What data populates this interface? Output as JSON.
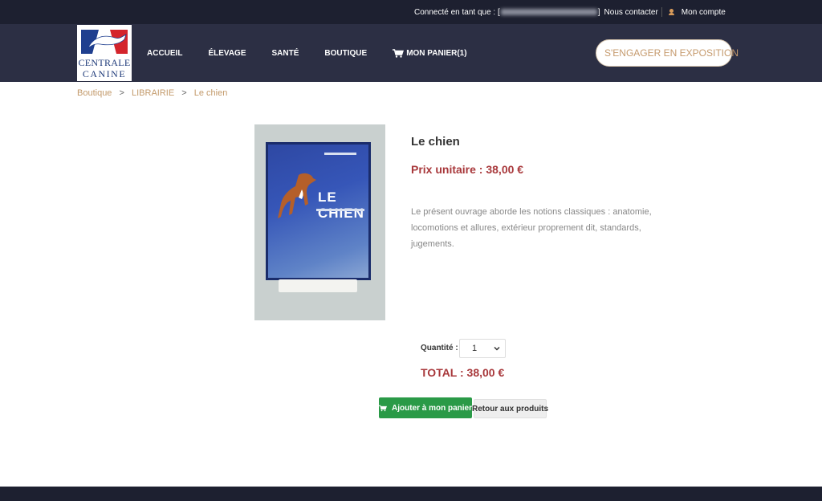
{
  "topbar": {
    "connected_prefix": "Connecté en tant que : [",
    "connected_suffix": "]",
    "contact_label": "Nous contacter",
    "account_label": "Mon compte"
  },
  "logo": {
    "line1": "CENTRALE",
    "line2": "CANINE"
  },
  "nav": {
    "items": [
      "ACCUEIL",
      "ÉLEVAGE",
      "SANTÉ",
      "BOUTIQUE"
    ],
    "cart_label": "MON PANIER(1)",
    "cta_label": "S'ENGAGER EN EXPOSITION"
  },
  "breadcrumb": {
    "items": [
      "Boutique",
      "LIBRAIRIE",
      "Le chien"
    ],
    "separator": ">"
  },
  "product": {
    "cover_title": "LE CHIEN",
    "title": "Le chien",
    "unit_price": "Prix unitaire : 38,00 €",
    "description": "Le présent ouvrage aborde les notions classiques : anatomie, locomotions et allures, extérieur proprement dit, standards, jugements."
  },
  "order": {
    "quantity_label": "Quantité :",
    "quantity_value": "1",
    "total": "TOTAL : 38,00 €",
    "add_to_cart_label": "Ajouter à mon panier",
    "back_label": "Retour aux produits"
  },
  "colors": {
    "topbar_bg": "#1d2030",
    "navbar_bg": "#2c2f44",
    "accent_gold": "#c39a6b",
    "price_red": "#a8383b",
    "button_green": "#2a9a47"
  },
  "icons": {
    "cart": "cart-icon",
    "user": "user-icon",
    "dogs": "dogs-icon",
    "chevron": "chevron-down-icon"
  }
}
